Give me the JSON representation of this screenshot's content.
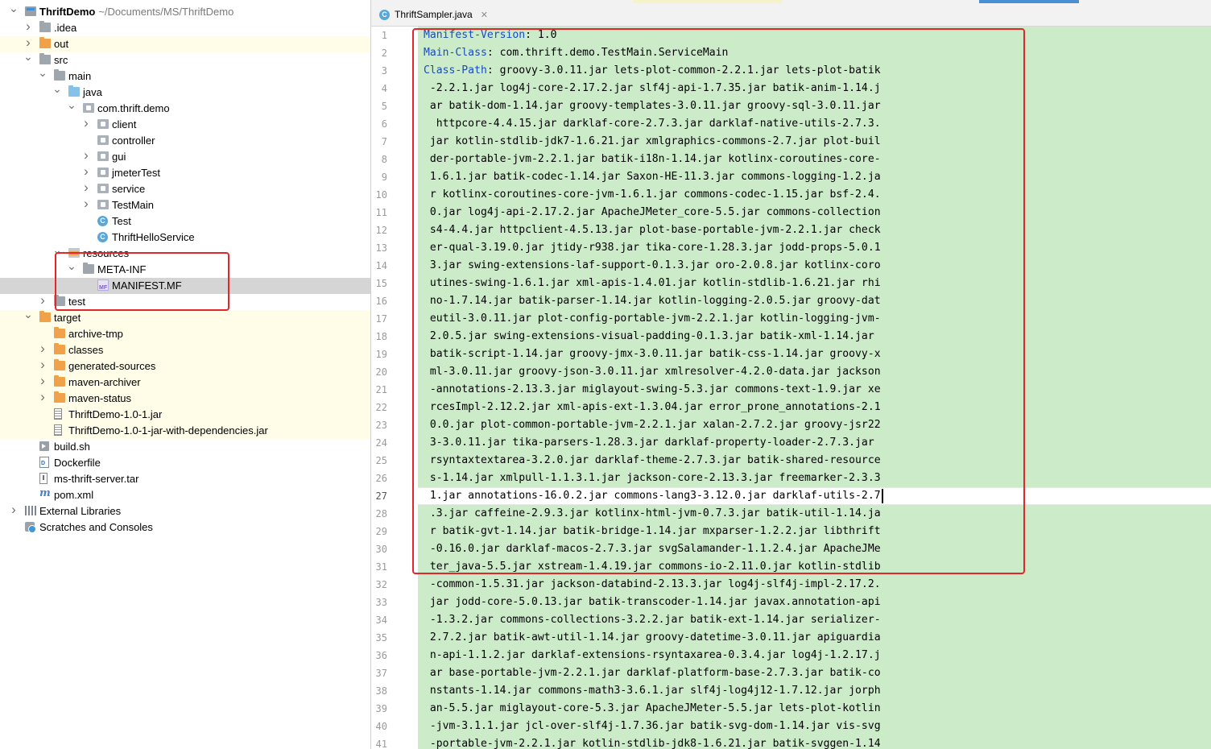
{
  "project_tree": {
    "rows": [
      {
        "depth": 0,
        "arrow": "down",
        "icon": "project",
        "label": "ThriftDemo",
        "sub": "~/Documents/MS/ThriftDemo",
        "bold": true,
        "hl": false
      },
      {
        "depth": 1,
        "arrow": "right",
        "icon": "folder-gray",
        "label": ".idea",
        "hl": false
      },
      {
        "depth": 1,
        "arrow": "right",
        "icon": "folder-orange",
        "label": "out",
        "hl": true
      },
      {
        "depth": 1,
        "arrow": "down",
        "icon": "folder-gray",
        "label": "src",
        "hl": false
      },
      {
        "depth": 2,
        "arrow": "down",
        "icon": "folder-gray",
        "label": "main",
        "hl": false
      },
      {
        "depth": 3,
        "arrow": "down",
        "icon": "folder-blue",
        "label": "java",
        "hl": false
      },
      {
        "depth": 4,
        "arrow": "down",
        "icon": "package",
        "label": "com.thrift.demo",
        "hl": false
      },
      {
        "depth": 5,
        "arrow": "right",
        "icon": "package",
        "label": "client",
        "hl": false
      },
      {
        "depth": 5,
        "arrow": "",
        "icon": "package",
        "label": "controller",
        "hl": false
      },
      {
        "depth": 5,
        "arrow": "right",
        "icon": "package",
        "label": "gui",
        "hl": false
      },
      {
        "depth": 5,
        "arrow": "right",
        "icon": "package",
        "label": "jmeterTest",
        "hl": false
      },
      {
        "depth": 5,
        "arrow": "right",
        "icon": "package",
        "label": "service",
        "hl": false
      },
      {
        "depth": 5,
        "arrow": "right",
        "icon": "package",
        "label": "TestMain",
        "hl": false
      },
      {
        "depth": 5,
        "arrow": "",
        "icon": "class",
        "label": "Test",
        "hl": false
      },
      {
        "depth": 5,
        "arrow": "",
        "icon": "class",
        "label": "ThriftHelloService",
        "hl": false
      },
      {
        "depth": 3,
        "arrow": "down",
        "icon": "resources",
        "label": "resources",
        "hl": false
      },
      {
        "depth": 4,
        "arrow": "down",
        "icon": "folder-gray",
        "label": "META-INF",
        "hl": false
      },
      {
        "depth": 5,
        "arrow": "",
        "icon": "manifest",
        "label": "MANIFEST.MF",
        "hl": false,
        "selected": true
      },
      {
        "depth": 2,
        "arrow": "right",
        "icon": "folder-gray",
        "label": "test",
        "hl": false
      },
      {
        "depth": 1,
        "arrow": "down",
        "icon": "folder-orange",
        "label": "target",
        "hl": true
      },
      {
        "depth": 2,
        "arrow": "",
        "icon": "folder-orange",
        "label": "archive-tmp",
        "hl": true
      },
      {
        "depth": 2,
        "arrow": "right",
        "icon": "folder-orange",
        "label": "classes",
        "hl": true
      },
      {
        "depth": 2,
        "arrow": "right",
        "icon": "folder-orange",
        "label": "generated-sources",
        "hl": true
      },
      {
        "depth": 2,
        "arrow": "right",
        "icon": "folder-orange",
        "label": "maven-archiver",
        "hl": true
      },
      {
        "depth": 2,
        "arrow": "right",
        "icon": "folder-orange",
        "label": "maven-status",
        "hl": true
      },
      {
        "depth": 2,
        "arrow": "",
        "icon": "jar",
        "label": "ThriftDemo-1.0-1.jar",
        "hl": true
      },
      {
        "depth": 2,
        "arrow": "",
        "icon": "jar",
        "label": "ThriftDemo-1.0-1-jar-with-dependencies.jar",
        "hl": true
      },
      {
        "depth": 1,
        "arrow": "",
        "icon": "shell",
        "label": "build.sh",
        "hl": false
      },
      {
        "depth": 1,
        "arrow": "",
        "icon": "dockerfile",
        "label": "Dockerfile",
        "hl": false
      },
      {
        "depth": 1,
        "arrow": "",
        "icon": "tar",
        "label": "ms-thrift-server.tar",
        "hl": false
      },
      {
        "depth": 1,
        "arrow": "",
        "icon": "pom",
        "label": "pom.xml",
        "hl": false
      },
      {
        "depth": 0,
        "arrow": "right",
        "icon": "libraries",
        "label": "External Libraries",
        "hl": false
      },
      {
        "depth": 0,
        "arrow": "",
        "icon": "scratches",
        "label": "Scratches and Consoles",
        "hl": false
      }
    ]
  },
  "editor": {
    "tab_label": "ThriftSampler.java",
    "tab_icon": "C",
    "current_line": 27,
    "lines": [
      {
        "n": 1,
        "key": "Manifest-Version",
        "rest": ": 1.0"
      },
      {
        "n": 2,
        "key": "Main-Class",
        "rest": ": com.thrift.demo.TestMain.ServiceMain"
      },
      {
        "n": 3,
        "key": "Class-Path",
        "rest": ": groovy-3.0.11.jar lets-plot-common-2.2.1.jar lets-plot-batik"
      },
      {
        "n": 4,
        "key": "",
        "rest": " -2.2.1.jar log4j-core-2.17.2.jar slf4j-api-1.7.35.jar batik-anim-1.14.j"
      },
      {
        "n": 5,
        "key": "",
        "rest": " ar batik-dom-1.14.jar groovy-templates-3.0.11.jar groovy-sql-3.0.11.jar"
      },
      {
        "n": 6,
        "key": "",
        "rest": "  httpcore-4.4.15.jar darklaf-core-2.7.3.jar darklaf-native-utils-2.7.3."
      },
      {
        "n": 7,
        "key": "",
        "rest": " jar kotlin-stdlib-jdk7-1.6.21.jar xmlgraphics-commons-2.7.jar plot-buil"
      },
      {
        "n": 8,
        "key": "",
        "rest": " der-portable-jvm-2.2.1.jar batik-i18n-1.14.jar kotlinx-coroutines-core-"
      },
      {
        "n": 9,
        "key": "",
        "rest": " 1.6.1.jar batik-codec-1.14.jar Saxon-HE-11.3.jar commons-logging-1.2.ja"
      },
      {
        "n": 10,
        "key": "",
        "rest": " r kotlinx-coroutines-core-jvm-1.6.1.jar commons-codec-1.15.jar bsf-2.4."
      },
      {
        "n": 11,
        "key": "",
        "rest": " 0.jar log4j-api-2.17.2.jar ApacheJMeter_core-5.5.jar commons-collection"
      },
      {
        "n": 12,
        "key": "",
        "rest": " s4-4.4.jar httpclient-4.5.13.jar plot-base-portable-jvm-2.2.1.jar check"
      },
      {
        "n": 13,
        "key": "",
        "rest": " er-qual-3.19.0.jar jtidy-r938.jar tika-core-1.28.3.jar jodd-props-5.0.1"
      },
      {
        "n": 14,
        "key": "",
        "rest": " 3.jar swing-extensions-laf-support-0.1.3.jar oro-2.0.8.jar kotlinx-coro"
      },
      {
        "n": 15,
        "key": "",
        "rest": " utines-swing-1.6.1.jar xml-apis-1.4.01.jar kotlin-stdlib-1.6.21.jar rhi"
      },
      {
        "n": 16,
        "key": "",
        "rest": " no-1.7.14.jar batik-parser-1.14.jar kotlin-logging-2.0.5.jar groovy-dat"
      },
      {
        "n": 17,
        "key": "",
        "rest": " eutil-3.0.11.jar plot-config-portable-jvm-2.2.1.jar kotlin-logging-jvm-"
      },
      {
        "n": 18,
        "key": "",
        "rest": " 2.0.5.jar swing-extensions-visual-padding-0.1.3.jar batik-xml-1.14.jar"
      },
      {
        "n": 19,
        "key": "",
        "rest": " batik-script-1.14.jar groovy-jmx-3.0.11.jar batik-css-1.14.jar groovy-x"
      },
      {
        "n": 20,
        "key": "",
        "rest": " ml-3.0.11.jar groovy-json-3.0.11.jar xmlresolver-4.2.0-data.jar jackson"
      },
      {
        "n": 21,
        "key": "",
        "rest": " -annotations-2.13.3.jar miglayout-swing-5.3.jar commons-text-1.9.jar xe"
      },
      {
        "n": 22,
        "key": "",
        "rest": " rcesImpl-2.12.2.jar xml-apis-ext-1.3.04.jar error_prone_annotations-2.1"
      },
      {
        "n": 23,
        "key": "",
        "rest": " 0.0.jar plot-common-portable-jvm-2.2.1.jar xalan-2.7.2.jar groovy-jsr22"
      },
      {
        "n": 24,
        "key": "",
        "rest": " 3-3.0.11.jar tika-parsers-1.28.3.jar darklaf-property-loader-2.7.3.jar"
      },
      {
        "n": 25,
        "key": "",
        "rest": " rsyntaxtextarea-3.2.0.jar darklaf-theme-2.7.3.jar batik-shared-resource"
      },
      {
        "n": 26,
        "key": "",
        "rest": " s-1.14.jar xmlpull-1.1.3.1.jar jackson-core-2.13.3.jar freemarker-2.3.3"
      },
      {
        "n": 27,
        "key": "",
        "rest": " 1.jar annotations-16.0.2.jar commons-lang3-3.12.0.jar darklaf-utils-2.7"
      },
      {
        "n": 28,
        "key": "",
        "rest": " .3.jar caffeine-2.9.3.jar kotlinx-html-jvm-0.7.3.jar batik-util-1.14.ja"
      },
      {
        "n": 29,
        "key": "",
        "rest": " r batik-gvt-1.14.jar batik-bridge-1.14.jar mxparser-1.2.2.jar libthrift"
      },
      {
        "n": 30,
        "key": "",
        "rest": " -0.16.0.jar darklaf-macos-2.7.3.jar svgSalamander-1.1.2.4.jar ApacheJMe"
      },
      {
        "n": 31,
        "key": "",
        "rest": " ter_java-5.5.jar xstream-1.4.19.jar commons-io-2.11.0.jar kotlin-stdlib"
      },
      {
        "n": 32,
        "key": "",
        "rest": " -common-1.5.31.jar jackson-databind-2.13.3.jar log4j-slf4j-impl-2.17.2."
      },
      {
        "n": 33,
        "key": "",
        "rest": " jar jodd-core-5.0.13.jar batik-transcoder-1.14.jar javax.annotation-api"
      },
      {
        "n": 34,
        "key": "",
        "rest": " -1.3.2.jar commons-collections-3.2.2.jar batik-ext-1.14.jar serializer-"
      },
      {
        "n": 35,
        "key": "",
        "rest": " 2.7.2.jar batik-awt-util-1.14.jar groovy-datetime-3.0.11.jar apiguardia"
      },
      {
        "n": 36,
        "key": "",
        "rest": " n-api-1.1.2.jar darklaf-extensions-rsyntaxarea-0.3.4.jar log4j-1.2.17.j"
      },
      {
        "n": 37,
        "key": "",
        "rest": " ar base-portable-jvm-2.2.1.jar darklaf-platform-base-2.7.3.jar batik-co"
      },
      {
        "n": 38,
        "key": "",
        "rest": " nstants-1.14.jar commons-math3-3.6.1.jar slf4j-log4j12-1.7.12.jar jorph"
      },
      {
        "n": 39,
        "key": "",
        "rest": " an-5.5.jar miglayout-core-5.3.jar ApacheJMeter-5.5.jar lets-plot-kotlin"
      },
      {
        "n": 40,
        "key": "",
        "rest": " -jvm-3.1.1.jar jcl-over-slf4j-1.7.36.jar batik-svg-dom-1.14.jar vis-svg"
      },
      {
        "n": 41,
        "key": "",
        "rest": " -portable-jvm-2.2.1.jar kotlin-stdlib-jdk8-1.6.21.jar batik-svggen-1.14"
      }
    ]
  },
  "colors": {
    "keyword": "#1a4ac7",
    "diff_added_bg": "#cbebc9",
    "highlight_box": "#e3262b",
    "excluded_bg": "#fffde7"
  }
}
